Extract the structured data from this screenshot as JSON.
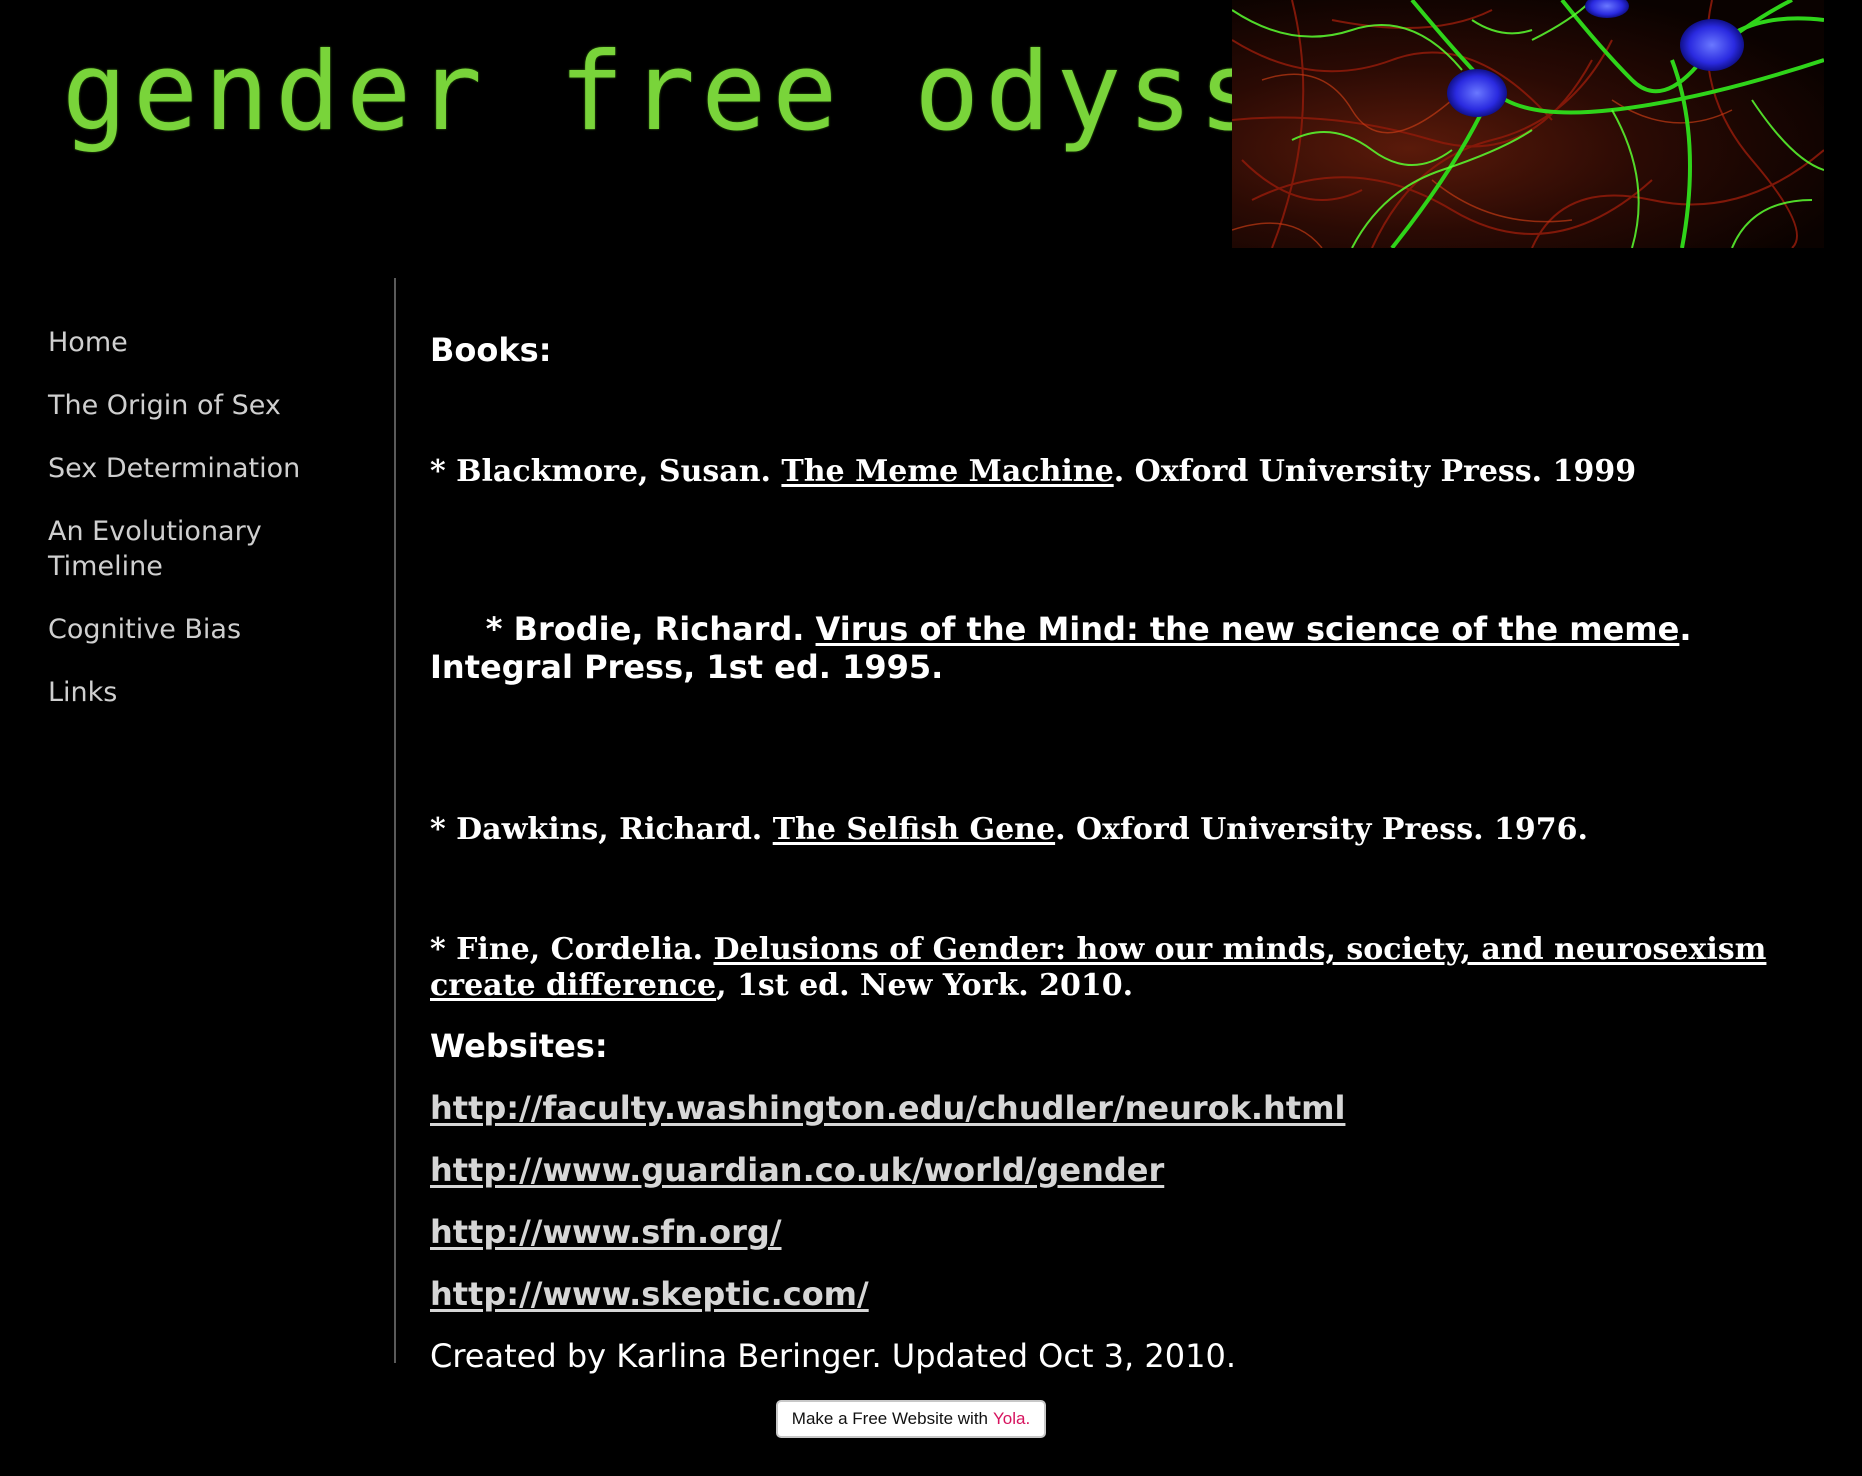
{
  "header": {
    "title": "gender free odyssey_"
  },
  "sidebar": {
    "items": [
      {
        "label": "Home"
      },
      {
        "label": "The Origin of Sex"
      },
      {
        "label": "Sex Determination"
      },
      {
        "label": "An Evolutionary Timeline"
      },
      {
        "label": "Cognitive Bias"
      },
      {
        "label": "Links"
      }
    ]
  },
  "content": {
    "books_heading": "Books:",
    "books": [
      {
        "prefix": "* Blackmore, Susan. ",
        "title": "The Meme Machine",
        "suffix": ". Oxford University Press. 1999"
      },
      {
        "prefix": " * Brodie, Richard. ",
        "title": "Virus of the Mind: the new science of the meme",
        "suffix": ". Integral Press, 1st ed. 1995."
      },
      {
        "prefix": "* Dawkins, Richard. ",
        "title": "The Selfish Gene",
        "suffix": ". Oxford University Press. 1976."
      },
      {
        "prefix": "* Fine, Cordelia. ",
        "title": "Delusions of Gender: how our minds, society, and neurosexism create difference",
        "suffix": ", 1st ed. New York. 2010."
      }
    ],
    "websites_heading": "Websites:",
    "websites": [
      "http://faculty.washington.edu/chudler/neurok.html",
      "http://www.guardian.co.uk/world/gender",
      "http://www.sfn.org/",
      "http://www.skeptic.com/"
    ],
    "credit": "Created by Karlina Beringer. Updated Oct 3, 2010."
  },
  "badge": {
    "text": "Make a Free Website with",
    "brand": "Yola."
  },
  "colors": {
    "title_green": "#79d43a",
    "background": "#000000",
    "nav_text": "#cfcfcf",
    "link_text": "#d6d6d6",
    "brand_pink": "#d6135e"
  }
}
